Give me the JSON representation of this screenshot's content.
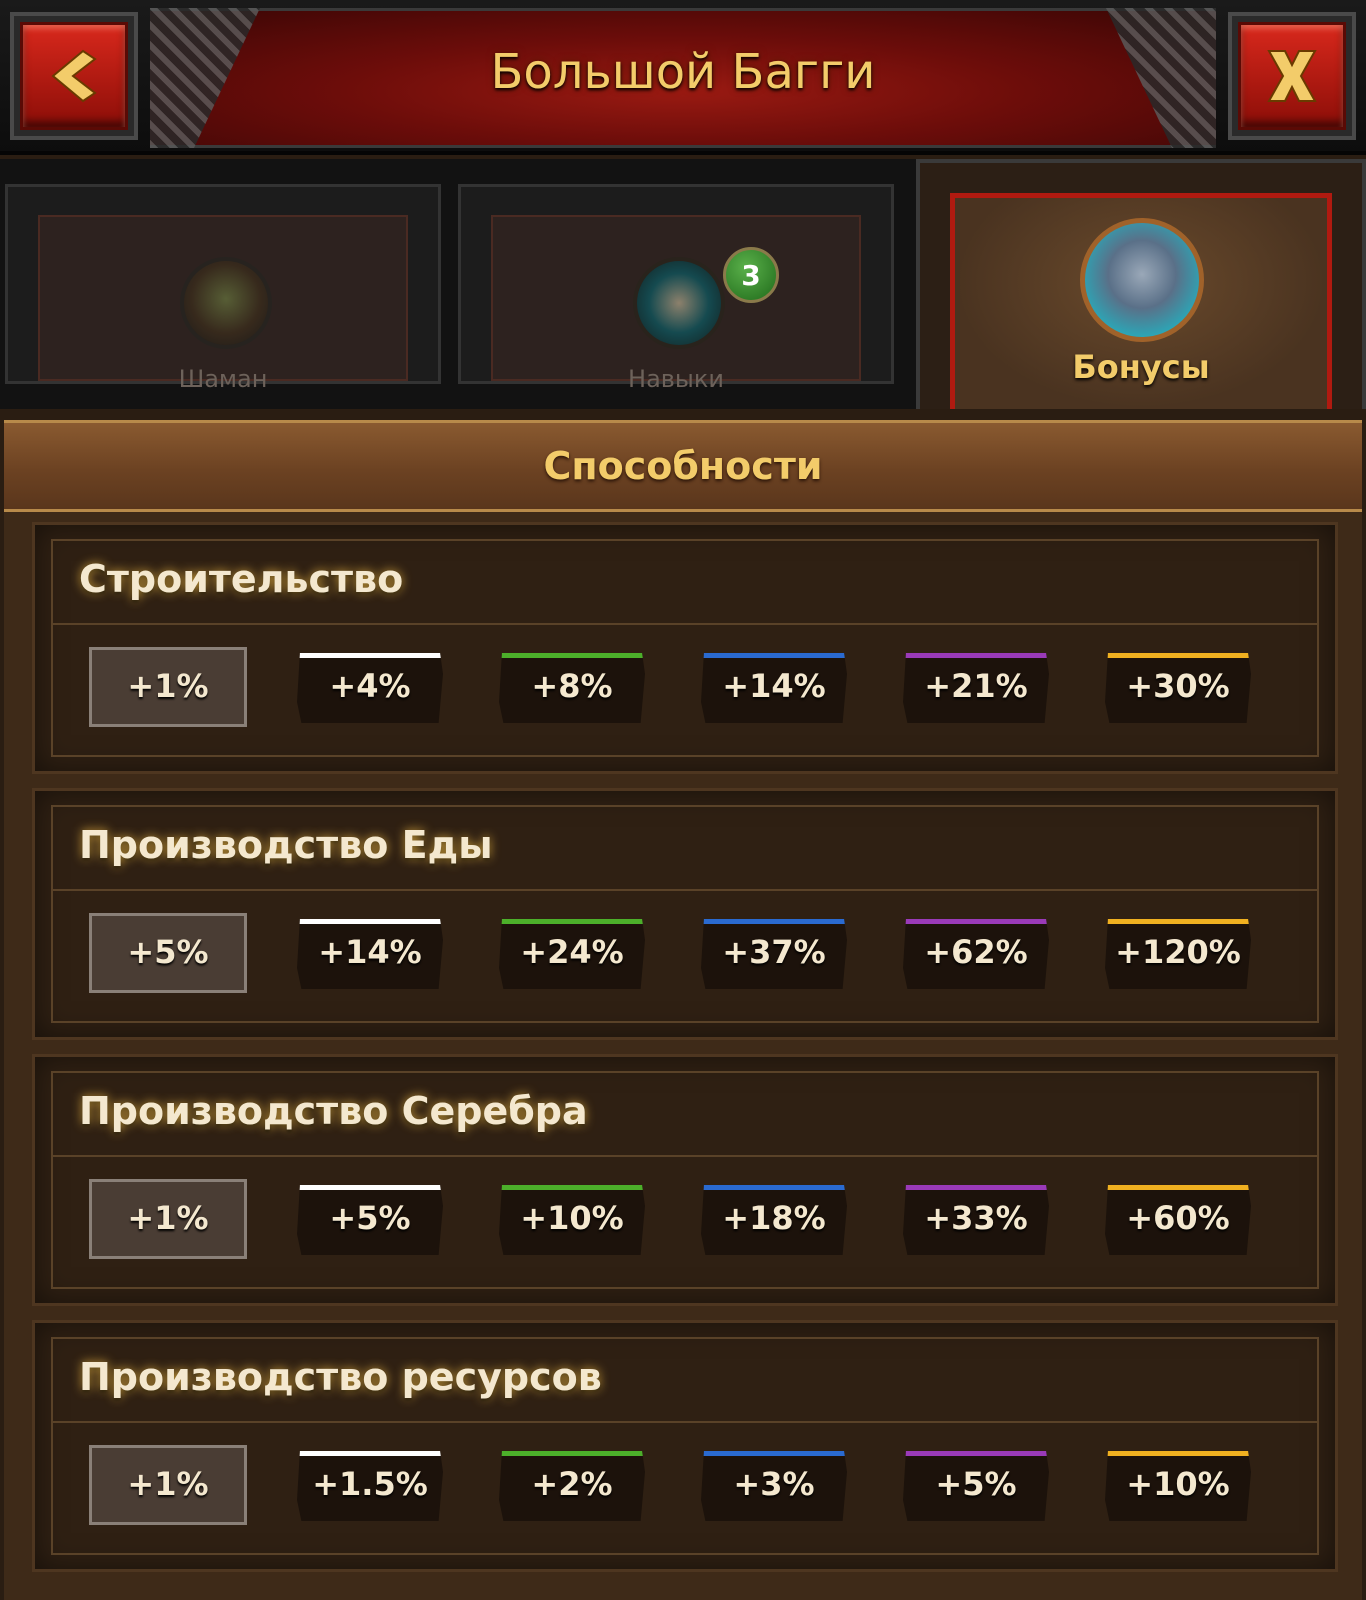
{
  "header": {
    "title": "Большой Багги",
    "back_icon": "chevron-left-icon",
    "close_icon": "close-x-icon",
    "button_color": "#c81e14",
    "title_color": "#f3cc6a"
  },
  "tabs": [
    {
      "label": "Шаман",
      "icon": "shaman-icon",
      "active": false
    },
    {
      "label": "Навыки",
      "icon": "skills-book-icon",
      "active": false,
      "badge": "3"
    },
    {
      "label": "Бонусы",
      "icon": "rune-stone-icon",
      "active": true
    }
  ],
  "section": {
    "title": "Способности"
  },
  "tier_colors": [
    "#9a9088",
    "#ffffff",
    "#4caf2a",
    "#2a6ad0",
    "#9a3ab8",
    "#f0b020"
  ],
  "abilities": [
    {
      "title": "Строительство",
      "values": [
        "+1%",
        "+4%",
        "+8%",
        "+14%",
        "+21%",
        "+30%"
      ]
    },
    {
      "title": "Производство Еды",
      "values": [
        "+5%",
        "+14%",
        "+24%",
        "+37%",
        "+62%",
        "+120%"
      ]
    },
    {
      "title": "Производство Серебра",
      "values": [
        "+1%",
        "+5%",
        "+10%",
        "+18%",
        "+33%",
        "+60%"
      ]
    },
    {
      "title": "Производство ресурсов",
      "values": [
        "+1%",
        "+1.5%",
        "+2%",
        "+3%",
        "+5%",
        "+10%"
      ]
    }
  ]
}
